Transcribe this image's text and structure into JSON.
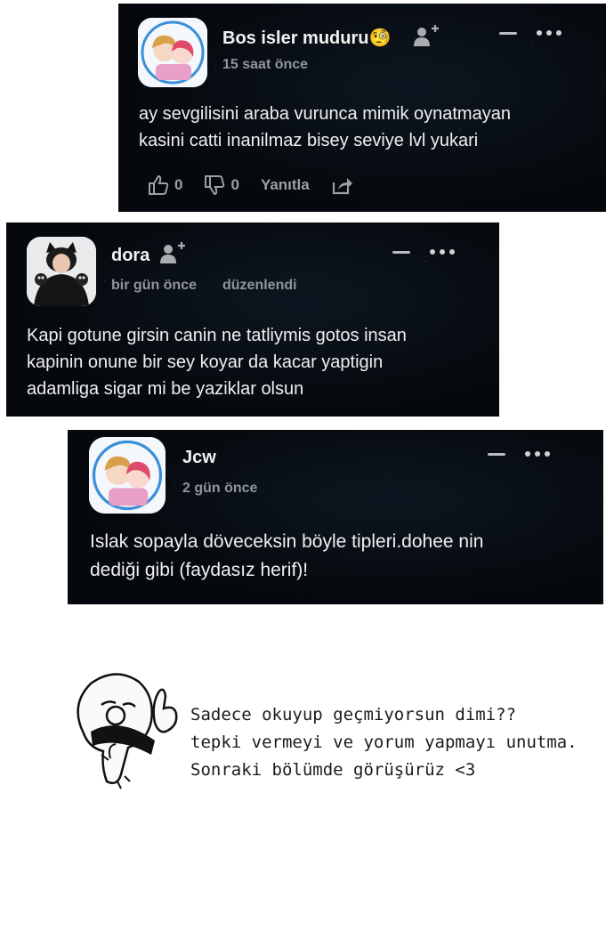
{
  "comments": [
    {
      "author": "Bos isler muduru",
      "author_emoji": "🧐",
      "time": "15 saat önce",
      "edited": "",
      "text_lines": [
        "ay sevgilisini araba vurunca mimik oynatmayan",
        "kasini catti inanilmaz bisey seviye lvl yukari"
      ],
      "likes": "0",
      "dislikes": "0",
      "reply_label": "Yanıtla"
    },
    {
      "author": "dora",
      "time": "bir gün önce",
      "edited": "düzenlendi",
      "text_lines": [
        "Kapi gotune girsin canin ne tatliymis gotos insan",
        "kapinin onune bir sey koyar da kacar yaptigin",
        "adamliga sigar mi be yaziklar olsun"
      ]
    },
    {
      "author": "Jcw",
      "time": "2 gün önce",
      "text_lines": [
        "Islak sopayla döveceksin böyle tipleri.dohee nin",
        "dediği gibi (faydasız herif)!"
      ]
    }
  ],
  "note_lines": [
    "Sadece okuyup geçmiyorsun dimi??",
    "tepki vermeyi ve yorum yapmayı unutma.",
    "Sonraki bölümde görüşürüz <3"
  ],
  "colors": {
    "card_bg": "#05080c",
    "muted": "#8f959b",
    "text": "#f0f0f0"
  }
}
